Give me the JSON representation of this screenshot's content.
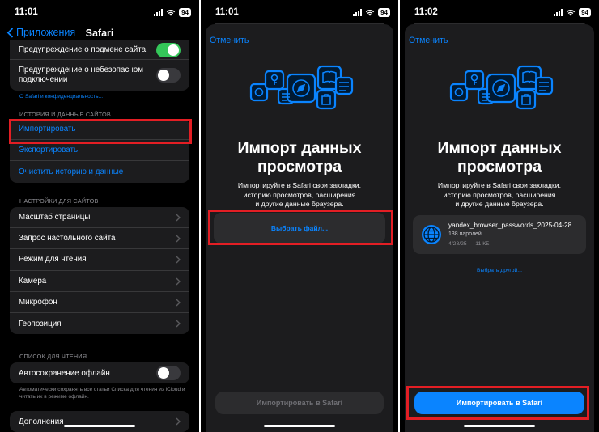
{
  "panels": [
    {
      "status_time": "11:01",
      "battery": "94",
      "back_label": "Приложения",
      "title": "Safari",
      "top_group": [
        {
          "label": "Предупреждение о подмене сайта",
          "toggle": true
        },
        {
          "label": "Предупреждение о небезопасном подключении",
          "toggle": false
        }
      ],
      "about_link": "О Safari и конфиденциальность...",
      "history_header": "ИСТОРИЯ И ДАННЫЕ САЙТОВ",
      "history_items": [
        "Импортировать",
        "Экспортировать",
        "Очистить историю и данные"
      ],
      "site_settings_header": "НАСТРОЙКИ ДЛЯ САЙТОВ",
      "site_settings_items": [
        "Масштаб страницы",
        "Запрос настольного сайта",
        "Режим для чтения",
        "Камера",
        "Микрофон",
        "Геопозиция"
      ],
      "reading_list_header": "СПИСОК ДЛЯ ЧТЕНИЯ",
      "autosave_label": "Автосохранение офлайн",
      "autosave_toggle": false,
      "autosave_note": "Автоматически сохранять все статьи Списка для чтения из iCloud и читать их в режиме офлайн.",
      "extensions_label": "Дополнения"
    },
    {
      "status_time": "11:01",
      "battery": "94",
      "cancel": "Отменить",
      "title_line1": "Импорт данных",
      "title_line2": "просмотра",
      "desc_line1": "Импортируйте в Safari свои закладки,",
      "desc_line2": "историю просмотров, расширения",
      "desc_line3": "и другие данные браузера.",
      "choose_file": "Выбрать файл...",
      "import_button": "Импортировать в Safari"
    },
    {
      "status_time": "11:02",
      "battery": "94",
      "cancel": "Отменить",
      "title_line1": "Импорт данных",
      "title_line2": "просмотра",
      "desc_line1": "Импортируйте в Safari свои закладки,",
      "desc_line2": "историю просмотров, расширения",
      "desc_line3": "и другие данные браузера.",
      "file_name": "yandex_browser_passwords_2025-04-28",
      "file_count": "138 паролей",
      "file_meta": "4/28/25 — 11 КБ",
      "choose_other": "Выбрать другой...",
      "import_button": "Импортировать в Safari"
    }
  ],
  "colors": {
    "accent": "#0a84ff",
    "highlight": "#e31e24",
    "toggle_on": "#34c759",
    "background": "#000000",
    "cell": "#1c1c1e"
  }
}
